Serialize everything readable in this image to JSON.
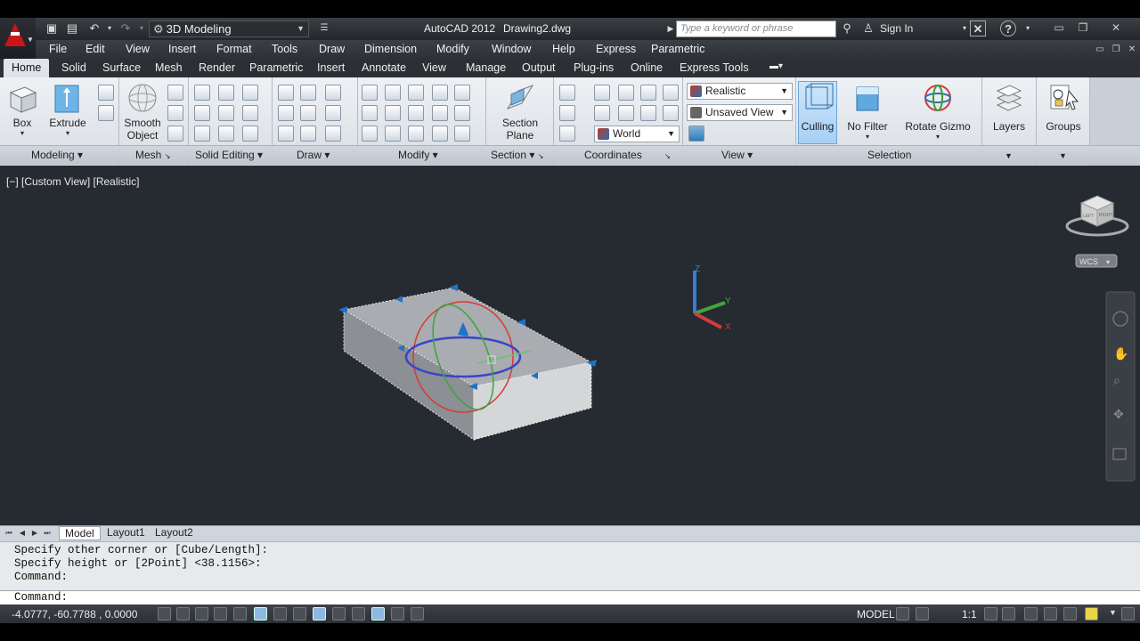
{
  "titlebar": {
    "workspace": "3D Modeling",
    "app_title": "AutoCAD 2012",
    "document": "Drawing2.dwg",
    "search_placeholder": "Type a keyword or phrase",
    "sign_in": "Sign In"
  },
  "menu": [
    "File",
    "Edit",
    "View",
    "Insert",
    "Format",
    "Tools",
    "Draw",
    "Dimension",
    "Modify",
    "Window",
    "Help",
    "Express",
    "Parametric"
  ],
  "ribbon_tabs": [
    "Home",
    "Solid",
    "Surface",
    "Mesh",
    "Render",
    "Parametric",
    "Insert",
    "Annotate",
    "View",
    "Manage",
    "Output",
    "Plug-ins",
    "Online",
    "Express Tools"
  ],
  "ribbon": {
    "box": "Box",
    "extrude": "Extrude",
    "smooth_object_1": "Smooth",
    "smooth_object_2": "Object",
    "section_plane_1": "Section",
    "section_plane_2": "Plane",
    "visual_style": "Realistic",
    "view": "Unsaved View",
    "ucs": "World",
    "culling": "Culling",
    "no_filter": "No Filter",
    "rotate_gizmo": "Rotate Gizmo",
    "layers": "Layers",
    "groups": "Groups"
  },
  "panels": [
    "Modeling",
    "Mesh",
    "Solid Editing",
    "Draw",
    "Modify",
    "Section",
    "Coordinates",
    "View",
    "Selection"
  ],
  "viewport": {
    "label": "[−] [Custom View] [Realistic]",
    "wcs": "WCS",
    "cube_face_left": "LEFT",
    "cube_face_front": "RIGHT",
    "axis_x": "X",
    "axis_y": "Y",
    "axis_z": "Z"
  },
  "layout_tabs": [
    "Model",
    "Layout1",
    "Layout2"
  ],
  "command": {
    "history": [
      "Specify other corner or [Cube/Length]:",
      "Specify height or [2Point] <38.1156>:",
      "Command:"
    ],
    "prompt": "Command:"
  },
  "status": {
    "coords": "-4.0777,  -60.7788 , 0.0000",
    "model": "MODEL",
    "scale": "1:1"
  },
  "colors": {
    "accent": "#1e73c8",
    "autocad_red": "#c8141a",
    "viewport_bg": "#262b31"
  }
}
